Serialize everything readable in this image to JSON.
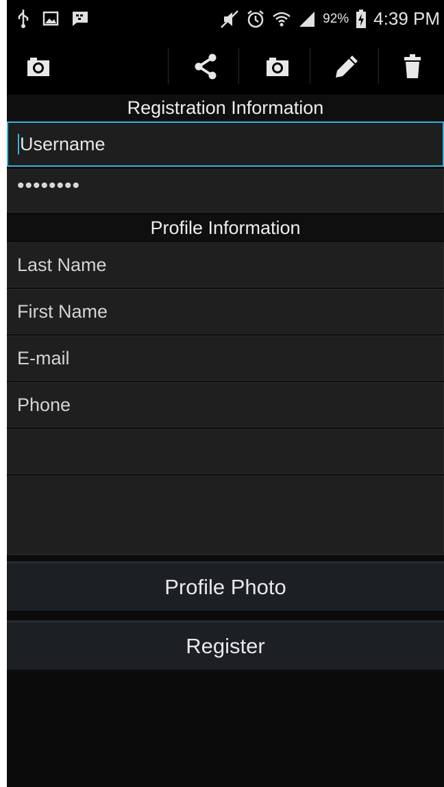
{
  "status_bar": {
    "battery_percent": "92%",
    "time": "4:39 PM",
    "icons": [
      "usb-icon",
      "gallery-icon",
      "bbm-icon",
      "mute-icon",
      "alarm-icon",
      "wifi-icon",
      "signal-icon",
      "battery-charging-icon"
    ]
  },
  "action_bar": {
    "icons": [
      "camera-icon",
      "share-icon",
      "camera-icon",
      "edit-icon",
      "delete-icon"
    ]
  },
  "registration": {
    "header": "Registration Information",
    "username_placeholder": "Username",
    "password_value": "••••••••"
  },
  "profile": {
    "header": "Profile Information",
    "last_name_placeholder": "Last Name",
    "first_name_placeholder": "First Name",
    "email_placeholder": "E-mail",
    "phone_placeholder": "Phone",
    "extra_field_value": "",
    "notes_value": ""
  },
  "buttons": {
    "profile_photo": "Profile Photo",
    "register": "Register"
  },
  "colors": {
    "accent": "#33b5e5",
    "field_bg": "#1f1f1f",
    "button_bg": "#1c2024",
    "screen_bg": "#0b0b0b"
  }
}
